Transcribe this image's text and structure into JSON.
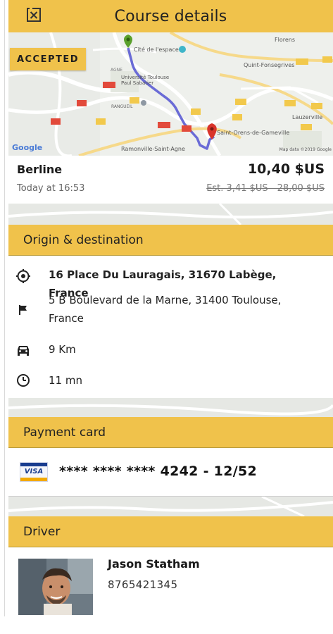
{
  "header": {
    "title": "Course details",
    "close_icon": "close-icon"
  },
  "map": {
    "status_badge": "ACCEPTED",
    "labels": [
      "Florens",
      "Quint-Fonsegrives",
      "Cité de l'espace",
      "Université Toulouse Paul Sabatier",
      "Rangueil",
      "Lauzerville",
      "Saint-Orens-de-Gameville",
      "Ramonville-Saint-Agne",
      "AGNE",
      "Map data ©2019 Google"
    ],
    "logo": "Google",
    "colors": {
      "route": "#6a6bd6",
      "origin_pin": "#5aa02c",
      "destination_pin": "#d9342b"
    }
  },
  "ride": {
    "vehicle_type": "Berline",
    "time": "Today at 16:53",
    "price": "10,40 $US",
    "estimate": "Est. 3,41 $US - 28,00 $US"
  },
  "origin_destination": {
    "title": "Origin & destination",
    "origin": "16 Place Du Lauragais, 31670 Labège, France",
    "destination": "5 B Boulevard de la Marne, 31400 Toulouse, France",
    "distance": "9 Km",
    "duration": "11 mn",
    "icons": [
      "target-icon",
      "flag-icon",
      "car-icon",
      "clock-icon"
    ]
  },
  "payment": {
    "title": "Payment card",
    "card_brand": "VISA",
    "card_number": "**** **** **** 4242 - 12/52"
  },
  "driver": {
    "title": "Driver",
    "name": "Jason Statham",
    "phone": "8765421345"
  },
  "colors": {
    "accent": "#f0c24b",
    "text": "#1a1a1a",
    "muted": "#666666"
  }
}
